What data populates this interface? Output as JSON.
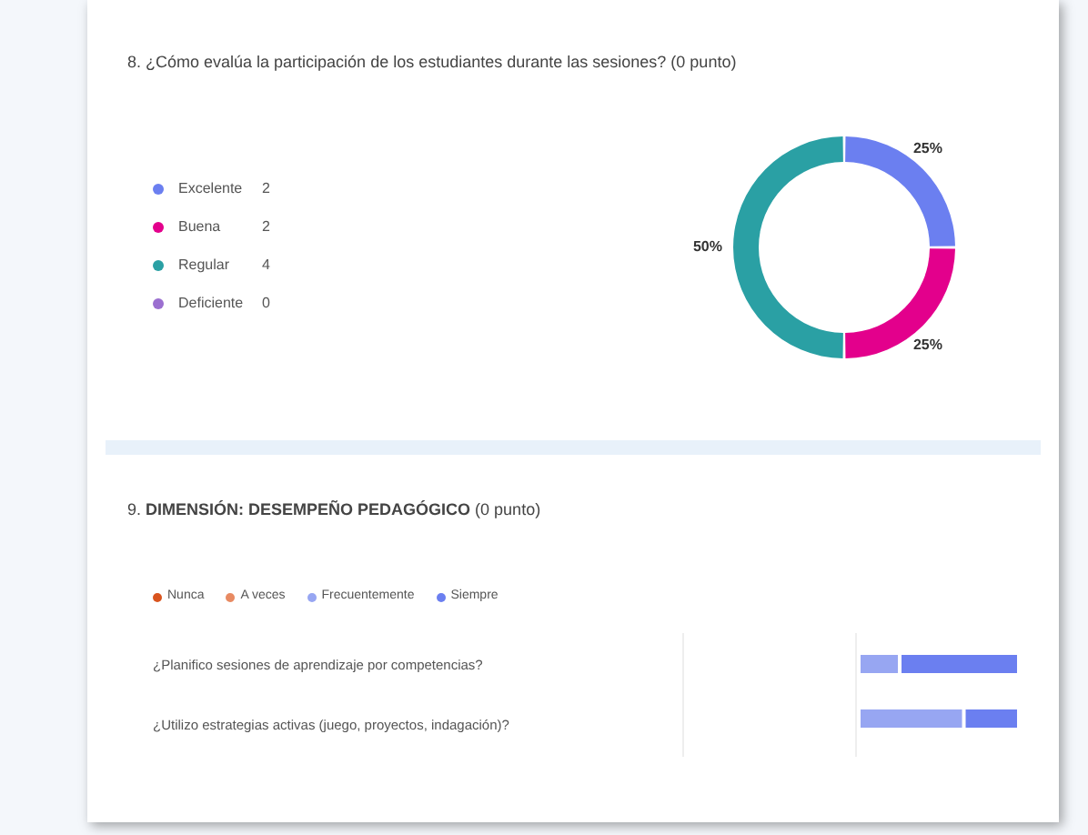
{
  "question_8": {
    "title": "8. ¿Cómo evalúa la participación de los estudiantes durante las sesiones? (0 punto)",
    "legend_counts": [
      "2",
      "2",
      "4",
      "0"
    ],
    "chart_data": {
      "type": "donut",
      "categories": [
        "Excelente",
        "Buena",
        "Regular",
        "Deficiente"
      ],
      "series": [
        {
          "values": [
            25,
            25,
            50,
            0
          ]
        }
      ],
      "colors": [
        "#6b7ff0",
        "#e3008c",
        "#2aa0a4",
        "#9b6fd0"
      ],
      "value_labels": [
        "25%",
        "25%",
        "50%",
        null
      ]
    }
  },
  "question_9": {
    "title": "9. **DIMENSIÓN: DESEMPEÑO PEDAGÓGICO** (0 punto)",
    "legend": [
      {
        "label": "Nunca",
        "color": "#d9541e"
      },
      {
        "label": "A veces",
        "color": "#e88a62"
      },
      {
        "label": "Frecuentemente",
        "color": "#97a6f2"
      },
      {
        "label": "Siempre",
        "color": "#6b7ff0"
      }
    ],
    "rows": [
      {
        "label": "¿Planifico sesiones de aprendizaje por competencias?"
      },
      {
        "label": "¿Utilizo estrategias activas (juego, proyectos, indagación)?"
      }
    ]
  }
}
